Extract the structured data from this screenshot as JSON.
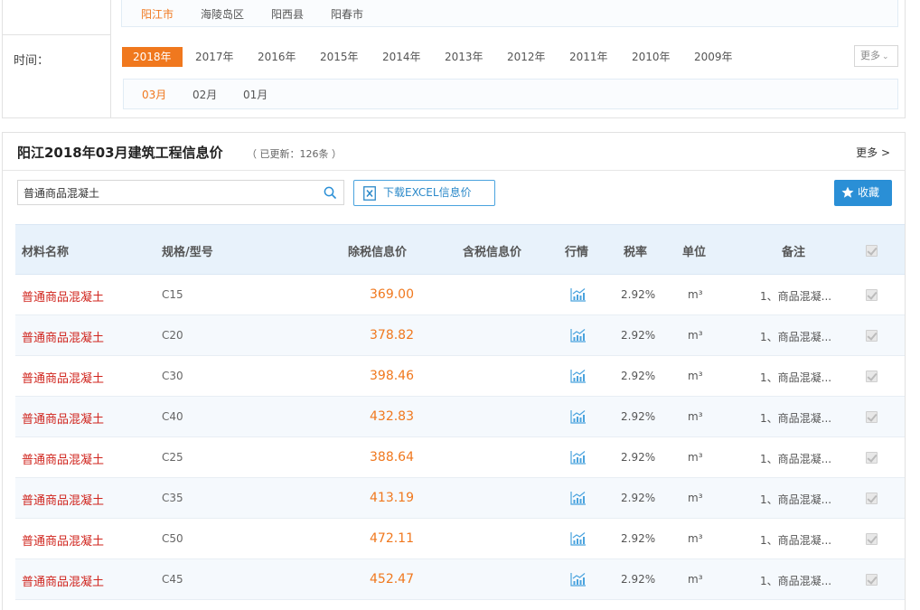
{
  "filters": {
    "regions": [
      {
        "label": "阳江市",
        "active": true
      },
      {
        "label": "海陵岛区",
        "active": false
      },
      {
        "label": "阳西县",
        "active": false
      },
      {
        "label": "阳春市",
        "active": false
      }
    ],
    "time_label": "时间：",
    "years": [
      {
        "label": "2018年",
        "active": true
      },
      {
        "label": "2017年",
        "active": false
      },
      {
        "label": "2016年",
        "active": false
      },
      {
        "label": "2015年",
        "active": false
      },
      {
        "label": "2014年",
        "active": false
      },
      {
        "label": "2013年",
        "active": false
      },
      {
        "label": "2012年",
        "active": false
      },
      {
        "label": "2011年",
        "active": false
      },
      {
        "label": "2010年",
        "active": false
      },
      {
        "label": "2009年",
        "active": false
      }
    ],
    "more_label": "更多",
    "months": [
      {
        "label": "03月",
        "active": true
      },
      {
        "label": "02月",
        "active": false
      },
      {
        "label": "01月",
        "active": false
      }
    ]
  },
  "main": {
    "title": "阳江2018年03月建筑工程信息价",
    "update_info": "（ 已更新：126条 ）",
    "more_label": "更多 >",
    "search_value": "普通商品混凝土",
    "excel_label": "下载EXCEL信息价",
    "favorite_label": "收藏"
  },
  "table": {
    "headers": {
      "name": "材料名称",
      "spec": "规格/型号",
      "price_ex_tax": "除税信息价",
      "price_inc_tax": "含税信息价",
      "trend": "行情",
      "tax_rate": "税率",
      "unit": "单位",
      "note": "备注"
    },
    "rows": [
      {
        "name": "普通商品混凝土",
        "spec": "C15",
        "price": "369.00",
        "tax": "2.92%",
        "unit": "m³",
        "note": "1、商品混凝..."
      },
      {
        "name": "普通商品混凝土",
        "spec": "C20",
        "price": "378.82",
        "tax": "2.92%",
        "unit": "m³",
        "note": "1、商品混凝..."
      },
      {
        "name": "普通商品混凝土",
        "spec": "C30",
        "price": "398.46",
        "tax": "2.92%",
        "unit": "m³",
        "note": "1、商品混凝..."
      },
      {
        "name": "普通商品混凝土",
        "spec": "C40",
        "price": "432.83",
        "tax": "2.92%",
        "unit": "m³",
        "note": "1、商品混凝..."
      },
      {
        "name": "普通商品混凝土",
        "spec": "C25",
        "price": "388.64",
        "tax": "2.92%",
        "unit": "m³",
        "note": "1、商品混凝..."
      },
      {
        "name": "普通商品混凝土",
        "spec": "C35",
        "price": "413.19",
        "tax": "2.92%",
        "unit": "m³",
        "note": "1、商品混凝..."
      },
      {
        "name": "普通商品混凝土",
        "spec": "C50",
        "price": "472.11",
        "tax": "2.92%",
        "unit": "m³",
        "note": "1、商品混凝..."
      },
      {
        "name": "普通商品混凝土",
        "spec": "C45",
        "price": "452.47",
        "tax": "2.92%",
        "unit": "m³",
        "note": "1、商品混凝..."
      }
    ]
  },
  "icons": {
    "search": "search-icon",
    "excel": "excel-icon",
    "star": "star-icon",
    "trend": "trend-chart-icon",
    "checkbox": "checkbox"
  },
  "colors": {
    "accent": "#f0781e",
    "link_red": "#d0251e",
    "primary_blue": "#2a8fd6",
    "header_bg": "#e8f2fb"
  }
}
